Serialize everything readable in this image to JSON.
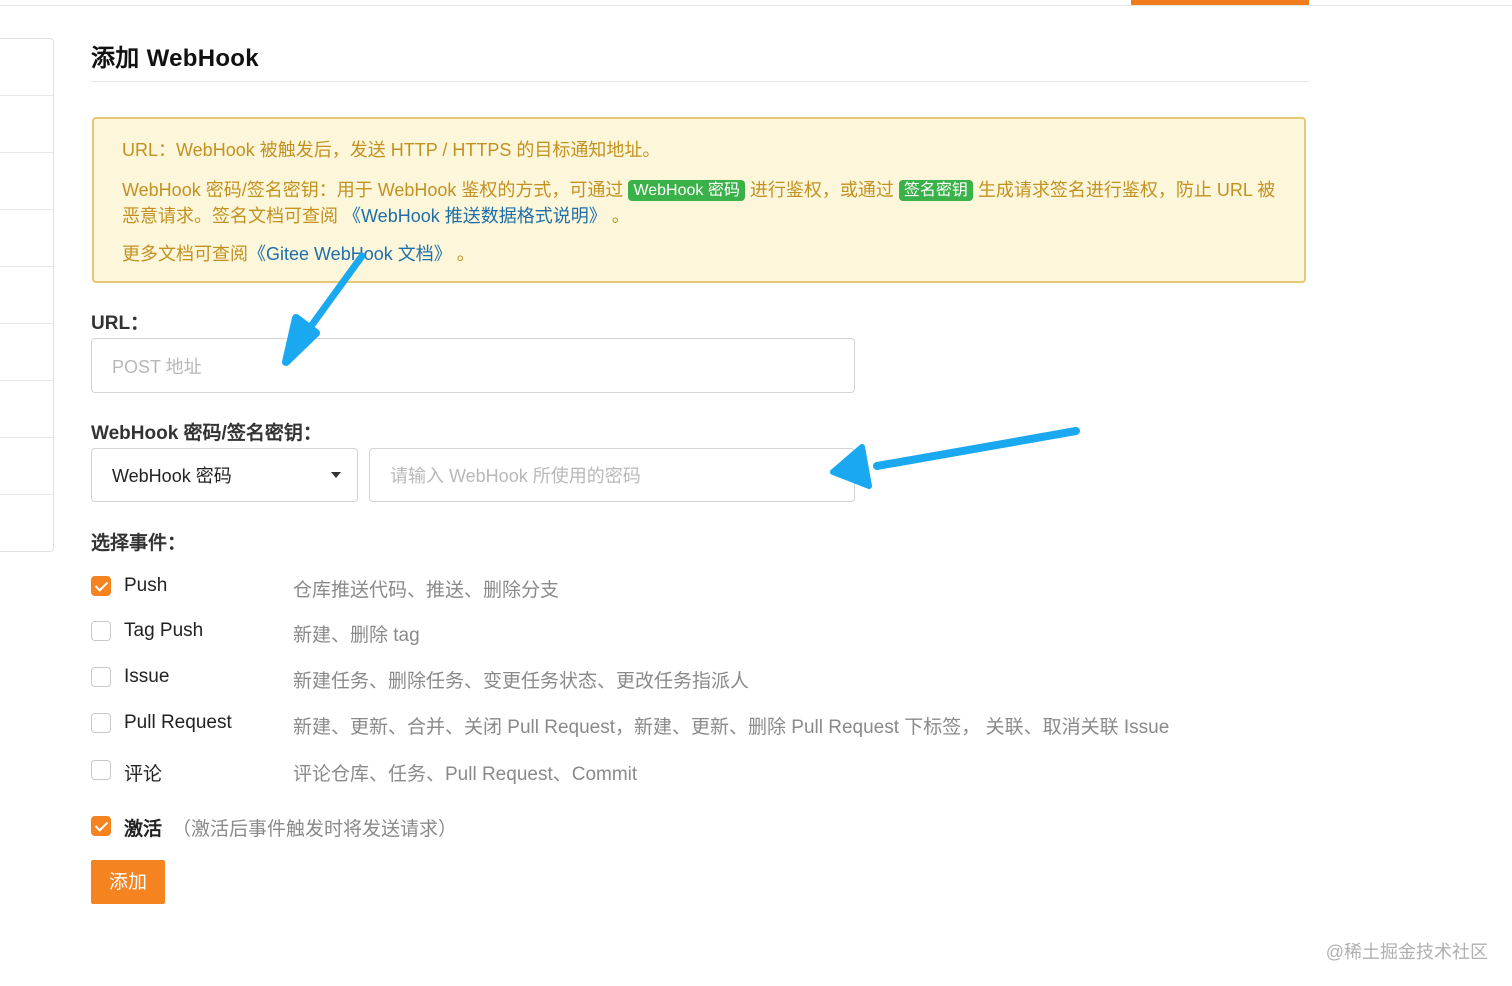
{
  "page": {
    "title": "添加 WebHook"
  },
  "notice": {
    "line1": "URL：WebHook 被触发后，发送 HTTP / HTTPS 的目标通知地址。",
    "line2_before": "WebHook 密码/签名密钥：用于 WebHook 鉴权的方式，可通过",
    "badge_password": "WebHook 密码",
    "line2_middle": "进行鉴权，或通过",
    "badge_signature": "签名密钥",
    "line2_after": "生成请求签名进行鉴权，防止 URL 被恶意请求。签名文档可查阅",
    "doc_link": "《WebHook 推送数据格式说明》",
    "line2_end": " 。",
    "line3_before": "更多文档可查阅",
    "gitee_link": "《Gitee WebHook 文档》",
    "line3_end": " 。"
  },
  "form": {
    "url_label": "URL：",
    "url_placeholder": "POST 地址",
    "secret_label": "WebHook 密码/签名密钥：",
    "secret_type_selected": "WebHook 密码",
    "secret_placeholder": "请输入 WebHook 所使用的密码",
    "events_label": "选择事件：",
    "events": [
      {
        "name": "Push",
        "desc": "仓库推送代码、推送、删除分支",
        "checked": true
      },
      {
        "name": "Tag Push",
        "desc": "新建、删除 tag",
        "checked": false
      },
      {
        "name": "Issue",
        "desc": "新建任务、删除任务、变更任务状态、更改任务指派人",
        "checked": false
      },
      {
        "name": "Pull Request",
        "desc": "新建、更新、合并、关闭 Pull Request，新建、更新、删除 Pull Request 下标签， 关联、取消关联 Issue",
        "checked": false
      },
      {
        "name": "评论",
        "desc": "评论仓库、任务、Pull Request、Commit",
        "checked": false
      }
    ],
    "activate_label": "激活",
    "activate_desc": "（激活后事件触发时将发送请求）",
    "activate_checked": true,
    "submit_label": "添加"
  },
  "watermark": "@稀土掘金技术社区",
  "colors": {
    "accent": "#f5831f",
    "notice_text": "#c39120",
    "notice_bg": "#fcf7db",
    "link": "#1f6ea8",
    "badge": "#3bb149",
    "annotation_arrow": "#1aa9f0"
  }
}
